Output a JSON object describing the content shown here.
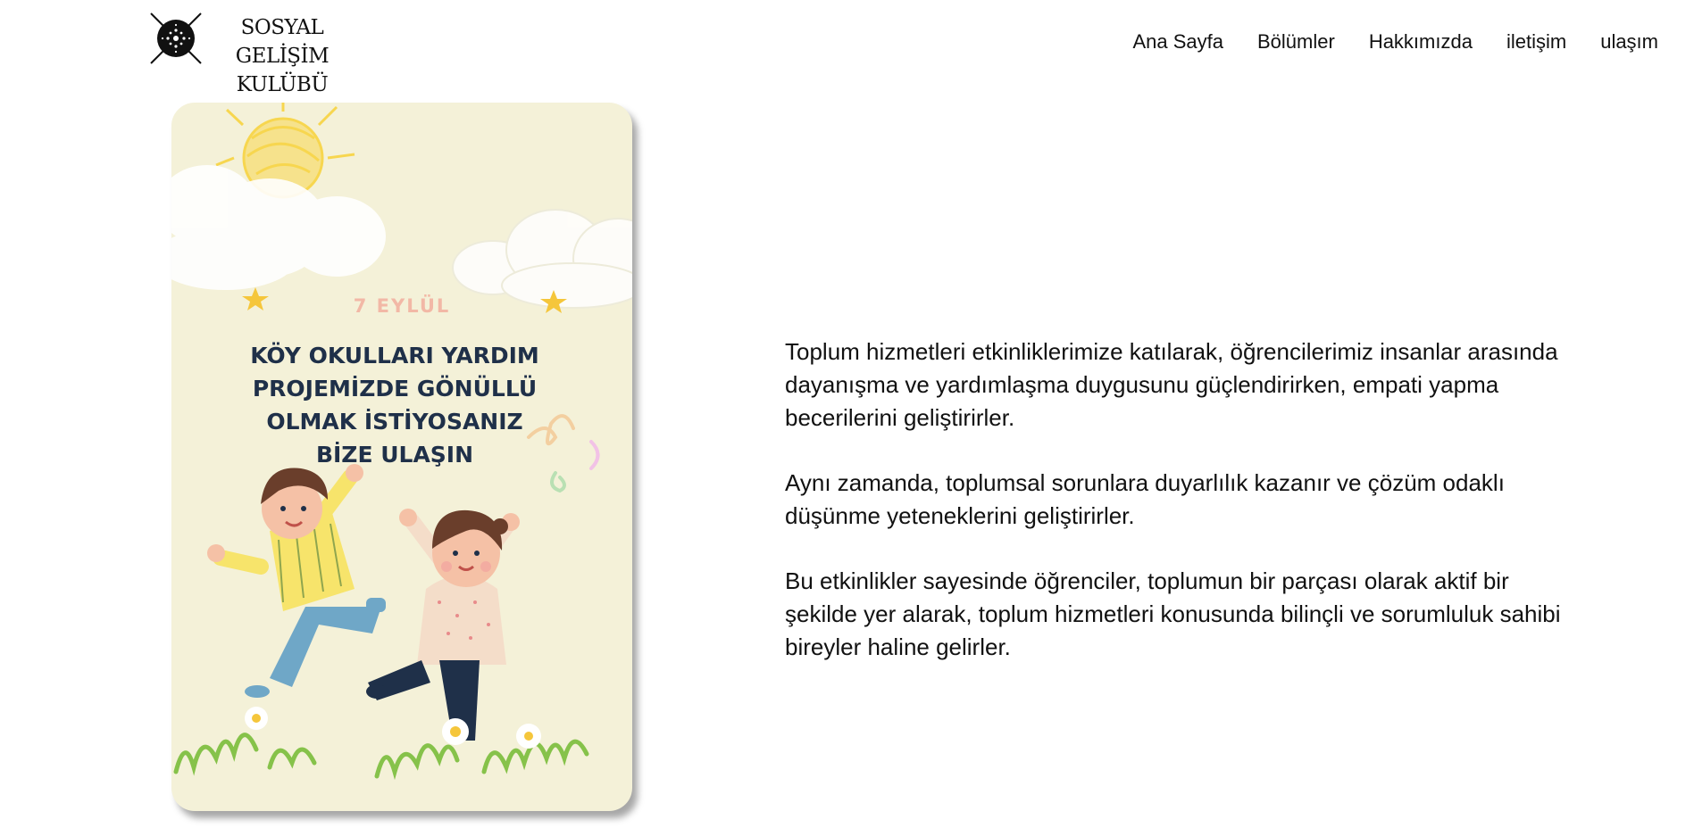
{
  "header": {
    "logo_text_line1": "SOSYAL GELİŞİM",
    "logo_text_line2": "KULÜBÜ",
    "nav": [
      "Ana Sayfa",
      "Bölümler",
      "Hakkımızda",
      "iletişim",
      "ulaşım"
    ]
  },
  "poster": {
    "date": "7 EYLÜL",
    "headline_lines": [
      "KÖY OKULLARI YARDIM",
      "PROJEMİZDE GÖNÜLLÜ",
      "OLMAK İSTİYOSANIZ",
      "BİZE ULAŞIN"
    ],
    "colors": {
      "background": "#f4f1d8",
      "headline": "#1f3049",
      "date": "#f2b8a6",
      "sun": "#f7d64f",
      "grass": "#86c24a"
    }
  },
  "content": {
    "paragraphs": [
      "Toplum hizmetleri etkinliklerimize katılarak, öğrencilerimiz insanlar arasında dayanışma ve yardımlaşma duygusunu güçlendirirken, empati yapma becerilerini geliştirirler.",
      "Aynı zamanda, toplumsal sorunlara duyarlılık kazanır ve çözüm odaklı düşünme yeteneklerini geliştirirler.",
      "Bu etkinlikler sayesinde öğrenciler, toplumun bir parçası olarak aktif bir şekilde yer alarak, toplum hizmetleri konusunda bilinçli ve sorumluluk sahibi bireyler haline gelirler."
    ]
  }
}
